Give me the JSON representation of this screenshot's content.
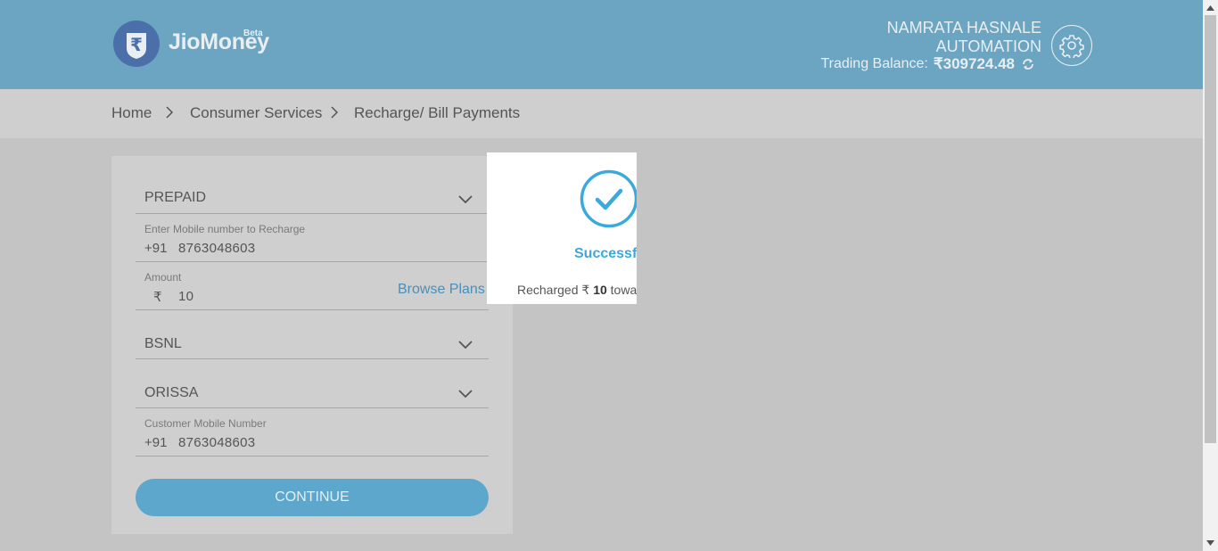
{
  "header": {
    "brand": "JioMoney",
    "beta": "Beta",
    "user_line1": "NAMRATA HASNALE",
    "user_line2": "AUTOMATION",
    "balance_label": "Trading Balance:",
    "balance_value": "₹309724.48",
    "colors": {
      "bar": "#6ba5c2",
      "text": "#e8eef2"
    }
  },
  "breadcrumb": [
    "Home",
    "Consumer Services",
    "Recharge/ Bill Payments"
  ],
  "form": {
    "plan_type": "PREPAID",
    "mobile_label": "Enter Mobile number to Recharge",
    "mobile_prefix": "+91",
    "mobile_value": "8763048603",
    "amount_label": "Amount",
    "currency_symbol": "₹",
    "amount_value": "10",
    "browse_plans": "Browse Plans",
    "operator": "BSNL",
    "circle": "ORISSA",
    "customer_label": "Customer Mobile Number",
    "customer_prefix": "+91",
    "customer_value": "8763048603",
    "continue": "CONTINUE"
  },
  "modal": {
    "title": "Successful",
    "recharged_prefix": "Recharged ₹",
    "recharged_amount": "10",
    "recharged_suffix": "towards",
    "accent": "#3aa9dd"
  },
  "icons": [
    "rupee-logo-icon",
    "gear-icon",
    "refresh-icon",
    "chevron-right-icon",
    "chevron-down-icon",
    "checkmark-circle-icon"
  ]
}
